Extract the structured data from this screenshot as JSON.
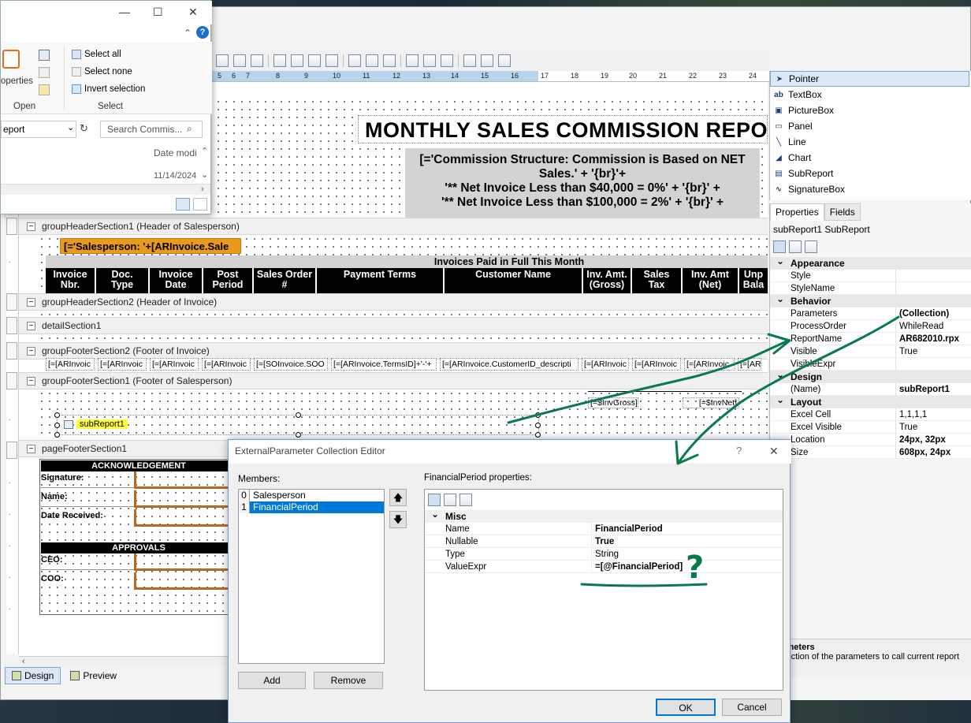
{
  "explorer": {
    "ribbon": {
      "properties_label": "operties",
      "open_group": "Open",
      "select_group": "Select",
      "select_all": "Select all",
      "select_none": "Select none",
      "invert_selection": "Invert selection"
    },
    "address": "eport",
    "search_placeholder": "Search Commis...",
    "column_header": "Date modi",
    "date_value": "11/14/2024"
  },
  "ruler": {
    "ticks": [
      "5",
      "6",
      "7",
      "8",
      "9",
      "10",
      "11",
      "12",
      "13",
      "14",
      "15",
      "16",
      "17",
      "18",
      "19",
      "20",
      "21",
      "22",
      "23",
      "24"
    ]
  },
  "report": {
    "title": "MONTHLY SALES COMMISSION REPO",
    "commission_lines": [
      "[='Commission Structure:  Commission is Based on NET",
      "Sales.' + '{br}'+",
      "'** Net Invoice Less than $40,000 = 0%' + '{br}' +",
      "'** Net Invoice Less than $100,000 = 2%' + '{br}' +"
    ],
    "salesperson_expr": "[='Salesperson:  '+[ARInvoice.Sale",
    "invoices_title": "Invoices Paid in Full This Month",
    "columns": [
      {
        "line1": "Invoice",
        "line2": "Nbr."
      },
      {
        "line1": "Doc.",
        "line2": "Type"
      },
      {
        "line1": "Invoice",
        "line2": "Date"
      },
      {
        "line1": "Post",
        "line2": "Period"
      },
      {
        "line1": "Sales Order",
        "line2": "#"
      },
      {
        "line1": "Payment Terms",
        "line2": ""
      },
      {
        "line1": "Customer Name",
        "line2": ""
      },
      {
        "line1": "Inv. Amt.",
        "line2": "(Gross)"
      },
      {
        "line1": "Sales",
        "line2": "Tax"
      },
      {
        "line1": "Inv. Amt",
        "line2": "(Net)"
      },
      {
        "line1": "Unp",
        "line2": "Bala"
      }
    ],
    "detail_cells": [
      "[=[ARInvoic",
      "[=[ARInvoic",
      "[=[ARInvoic",
      "[=[ARInvoic",
      "[=[SOInvoice.SOO",
      "[=[ARInvoice.TermsID]+'-'+",
      "[=[ARInvoice.CustomerID_descripti",
      "[=[ARInvoic",
      "[=[ARInvoic",
      "[=[ARInvoic",
      "[=[AR"
    ],
    "inv_gross": "[=$InvGross]",
    "inv_net": "[=$InvNet]",
    "subreport_label": "subReport1",
    "bands": {
      "group_header1": "groupHeaderSection1 (Header of Salesperson)",
      "group_header2": "groupHeaderSection2 (Header of Invoice)",
      "detail": "detailSection1",
      "group_footer2": "groupFooterSection2 (Footer of Invoice)",
      "group_footer1": "groupFooterSection1 (Footer of Salesperson)",
      "page_footer": "pageFooterSection1"
    },
    "footer": {
      "ack_title": "ACKNOWLEDGEMENT",
      "signature": "Signature:",
      "name": "Name:",
      "date_received": "Date Received:",
      "approvals_title": "APPROVALS",
      "ceo": "CEO:",
      "coo": "COO:"
    }
  },
  "bottom_tabs": {
    "design": "Design",
    "preview": "Preview"
  },
  "toolbox": {
    "items": [
      {
        "icon": "pointer-icon",
        "label": "Pointer"
      },
      {
        "icon": "textbox-icon",
        "label": "TextBox"
      },
      {
        "icon": "picturebox-icon",
        "label": "PictureBox"
      },
      {
        "icon": "panel-icon",
        "label": "Panel"
      },
      {
        "icon": "line-icon",
        "label": "Line"
      },
      {
        "icon": "chart-icon",
        "label": "Chart"
      },
      {
        "icon": "subreport-icon",
        "label": "SubReport"
      },
      {
        "icon": "signaturebox-icon",
        "label": "SignatureBox"
      }
    ]
  },
  "properties": {
    "tab_properties": "Properties",
    "tab_fields": "Fields",
    "object_name": "subReport1 SubReport",
    "categories": {
      "appearance": "Appearance",
      "behavior": "Behavior",
      "design": "Design",
      "layout": "Layout"
    },
    "rows": {
      "style": {
        "name": "Style",
        "value": ""
      },
      "style_name": {
        "name": "StyleName",
        "value": ""
      },
      "parameters": {
        "name": "Parameters",
        "value": "(Collection)"
      },
      "process_order": {
        "name": "ProcessOrder",
        "value": "WhileRead"
      },
      "report_name": {
        "name": "ReportName",
        "value": "AR682010.rpx"
      },
      "visible": {
        "name": "Visible",
        "value": "True"
      },
      "visible_expr": {
        "name": "VisibleExpr",
        "value": ""
      },
      "name": {
        "name": "(Name)",
        "value": "subReport1"
      },
      "excel_cell": {
        "name": "Excel Cell",
        "value": "1,1,1,1"
      },
      "excel_visible": {
        "name": "Excel Visible",
        "value": "True"
      },
      "location": {
        "name": "Location",
        "value": "24px, 32px"
      },
      "size": {
        "name": "Size",
        "value": "608px, 24px"
      }
    },
    "description_title": "arameters",
    "description_text": "collection of the parameters to call current report"
  },
  "dialog": {
    "title": "ExternalParameter Collection Editor",
    "help_glyph": "?",
    "members_label": "Members:",
    "members": [
      {
        "index": "0",
        "name": "Salesperson"
      },
      {
        "index": "1",
        "name": "FinancialPeriod"
      }
    ],
    "props_label": "FinancialPeriod properties:",
    "category": "Misc",
    "rows": [
      {
        "name": "Name",
        "value": "FinancialPeriod"
      },
      {
        "name": "Nullable",
        "value": "True"
      },
      {
        "name": "Type",
        "value": "String"
      },
      {
        "name": "ValueExpr",
        "value": "=[@FinancialPeriod]"
      }
    ],
    "add": "Add",
    "remove": "Remove",
    "ok": "OK",
    "cancel": "Cancel"
  },
  "annotation": {
    "mark": "?",
    "color": "#0b7a4a"
  }
}
